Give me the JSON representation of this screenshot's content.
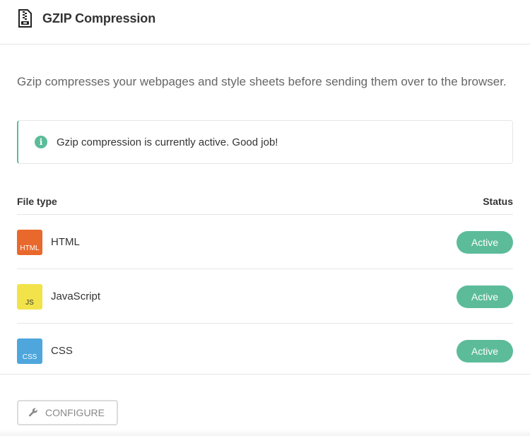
{
  "header": {
    "title": "GZIP Compression",
    "icon": "gzip-archive-icon"
  },
  "description": "Gzip compresses your webpages and style sheets before sending them over to the browser.",
  "notice": {
    "icon": "info-icon",
    "icon_glyph": "i",
    "text": "Gzip compression is currently active. Good job!"
  },
  "table": {
    "columns": {
      "file_type": "File type",
      "status": "Status"
    },
    "rows": [
      {
        "badge": "HTML",
        "name": "HTML",
        "status": "Active",
        "badge_color": "#e9692c",
        "badge_text_color": "#ffffff"
      },
      {
        "badge": "JS",
        "name": "JavaScript",
        "status": "Active",
        "badge_color": "#f2e34a",
        "badge_text_color": "#333333"
      },
      {
        "badge": "CSS",
        "name": "CSS",
        "status": "Active",
        "badge_color": "#4ea6dc",
        "badge_text_color": "#ffffff"
      }
    ]
  },
  "configure_button": {
    "label": "CONFIGURE",
    "icon": "wrench-icon"
  },
  "colors": {
    "accent": "#5cbc9a",
    "border": "#e6e6e6",
    "text": "#333333",
    "muted": "#666666"
  }
}
